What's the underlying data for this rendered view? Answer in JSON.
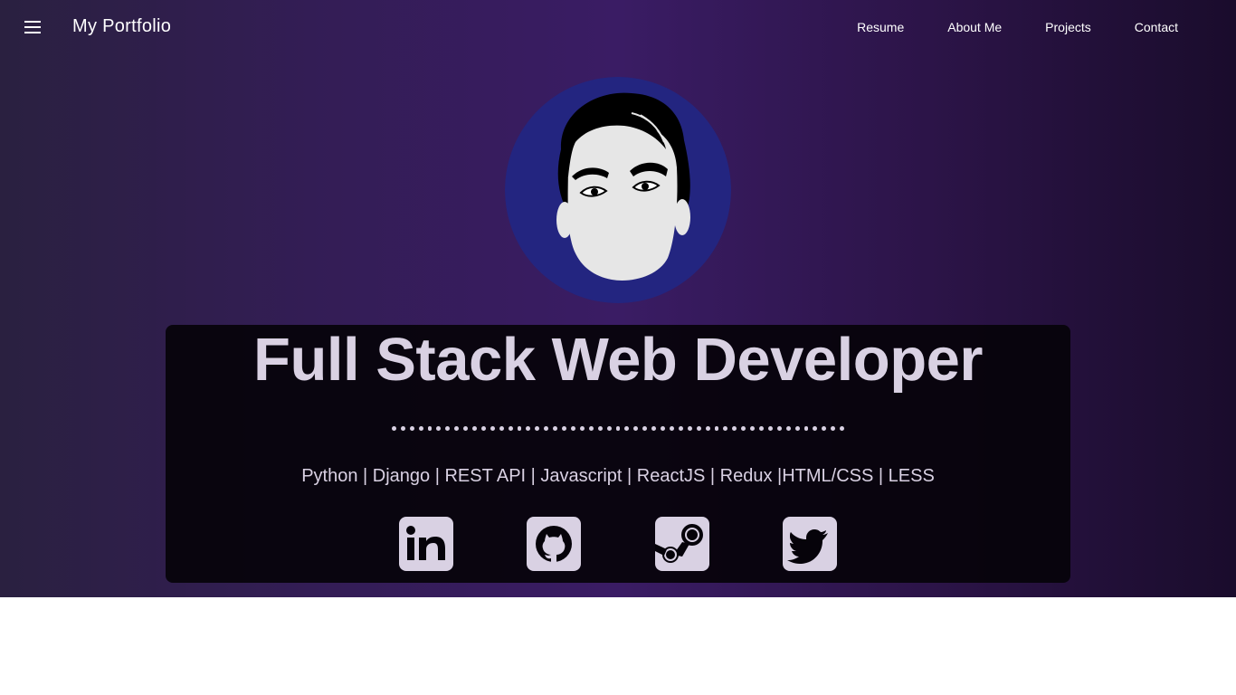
{
  "nav": {
    "menu_icon": "hamburger-menu-icon",
    "brand": "My Portfolio",
    "links": [
      "Resume",
      "About Me",
      "Projects",
      "Contact"
    ]
  },
  "hero": {
    "avatar_icon": "portrait-avatar-illustration",
    "title": "Full Stack Web Developer",
    "skills": "Python | Django | REST API | Javascript | ReactJS | Redux |HTML/CSS | LESS"
  },
  "social": [
    {
      "icon": "linkedin-icon"
    },
    {
      "icon": "github-icon"
    },
    {
      "icon": "steam-icon"
    },
    {
      "icon": "twitter-icon"
    }
  ],
  "colors": {
    "text_light": "#d9d1e3",
    "avatar_bg": "#232580",
    "panel_bg": "#06030a",
    "hero_purple": "#3a1c64"
  }
}
